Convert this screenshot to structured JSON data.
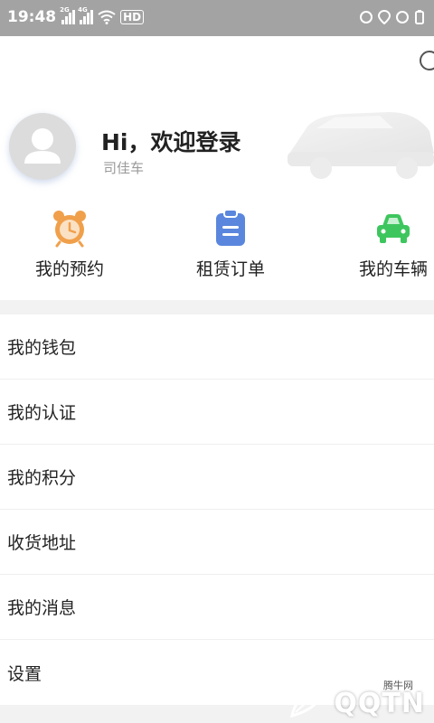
{
  "status_bar": {
    "time": "19:48",
    "network_1": "2G",
    "network_2": "4G",
    "hd": "HD"
  },
  "profile": {
    "title": "Hi，欢迎登录",
    "subtitle": "司佳车"
  },
  "quick_actions": [
    {
      "label": "我的预约",
      "icon": "alarm-clock-icon",
      "color": "#f0a04b"
    },
    {
      "label": "租赁订单",
      "icon": "clipboard-icon",
      "color": "#5a86dd"
    },
    {
      "label": "我的车辆",
      "icon": "car-icon",
      "color": "#3ec65e"
    }
  ],
  "menu": {
    "items": [
      {
        "label": "我的钱包"
      },
      {
        "label": "我的认证"
      },
      {
        "label": "我的积分"
      },
      {
        "label": "收货地址"
      },
      {
        "label": "我的消息"
      },
      {
        "label": "设置"
      }
    ]
  },
  "watermark": {
    "logo": "QQTN",
    "small": "腾牛网"
  }
}
